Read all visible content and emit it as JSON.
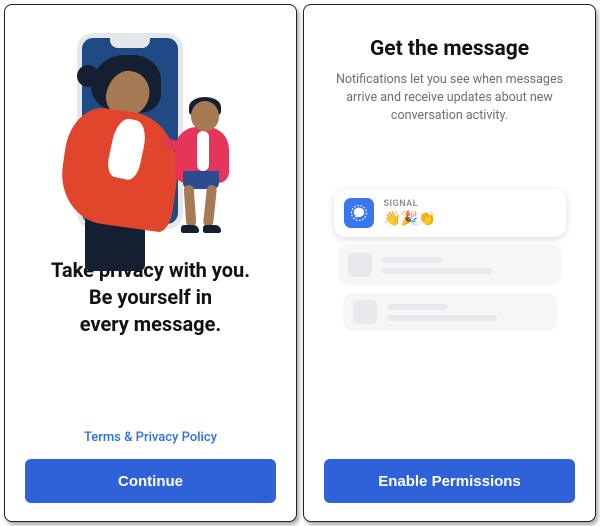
{
  "left": {
    "headline": "Take privacy with you.\nBe yourself in\nevery message.",
    "terms_link": "Terms & Privacy Policy",
    "continue_label": "Continue"
  },
  "right": {
    "title": "Get the message",
    "subtitle": "Notifications let you see when messages arrive and receive updates about new conversation activity.",
    "notification": {
      "app_name": "SIGNAL",
      "body": "👋🎉👏"
    },
    "enable_label": "Enable Permissions"
  }
}
